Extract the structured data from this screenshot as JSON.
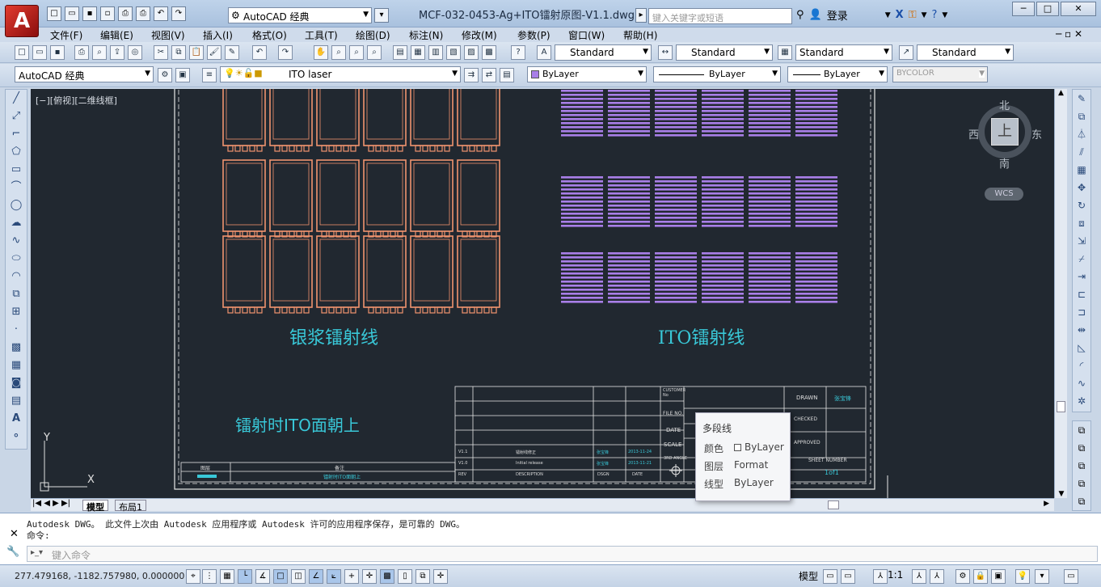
{
  "app": {
    "logo_letter": "A",
    "title": "MCF-032-0453-Ag+ITO镭射原图-V1.1.dwg",
    "workspace": "AutoCAD 经典",
    "search_placeholder": "键入关键字或短语",
    "login": "登录"
  },
  "menus": [
    "文件(F)",
    "编辑(E)",
    "视图(V)",
    "插入(I)",
    "格式(O)",
    "工具(T)",
    "绘图(D)",
    "标注(N)",
    "修改(M)",
    "参数(P)",
    "窗口(W)",
    "帮助(H)"
  ],
  "styles": {
    "text_style": "Standard",
    "dim_style": "Standard",
    "table_style": "Standard",
    "mleader_style": "Standard"
  },
  "layers": {
    "workspace2": "AutoCAD 经典",
    "current_layer": "ITO laser",
    "color": "ByLayer",
    "linetype": "ByLayer",
    "lineweight": "ByLayer",
    "plotstyle": "BYCOLOR"
  },
  "viewport": {
    "label": "[−][俯视][二维线框]"
  },
  "viewcube": {
    "north": "北",
    "south": "南",
    "east": "东",
    "west": "西",
    "top_face": "上",
    "wcs": "WCS"
  },
  "drawing": {
    "label_silver": "银浆镭射线",
    "label_ito": "ITO镭射线",
    "note_ito_up": "镭射时ITO面朝上",
    "title_block": {
      "customer": "CUSTOMER No",
      "file_no": "FILE NO.",
      "date": "DATE",
      "scale": "SCALE",
      "angle": "3RD ANGLE",
      "drawn": "DRAWN",
      "drawn_by": "张宝锋",
      "checked": "CHECKED",
      "approved": "APPROVED",
      "sheet_number": "SHEET NUMBER",
      "sheet": "1of1",
      "rows": [
        {
          "rev": "V1.1",
          "desc": "镭射线修正",
          "dsgn": "张宝锋",
          "date": "2013-11-24"
        },
        {
          "rev": "V1.0",
          "desc": "Initial release",
          "dsgn": "张宝锋",
          "date": "2013-11-21"
        }
      ],
      "hdr_rev": "REV",
      "hdr_desc": "DESCRIPTION",
      "hdr_dsgn": "DSGN",
      "hdr_date": "DATE",
      "legend_layer": "图层",
      "legend_note": "备注",
      "legend_note_val": "镭射时ITO面朝上"
    }
  },
  "tabs": {
    "model": "模型",
    "layout1": "布局1"
  },
  "tooltip": {
    "title": "多段线",
    "color_label": "颜色",
    "color_value": "ByLayer",
    "layer_label": "图层",
    "layer_value": "Format",
    "linetype_label": "线型",
    "linetype_value": "ByLayer"
  },
  "command": {
    "line1": "Autodesk DWG。  此文件上次由 Autodesk 应用程序或 Autodesk 许可的应用程序保存，是可靠的 DWG。",
    "line2": "命令:",
    "input_placeholder": "键入命令"
  },
  "status": {
    "coords": "277.479168, -1182.757980, 0.000000",
    "model": "模型",
    "scale": "1:1"
  },
  "colors": {
    "silver": "#f0936e",
    "ito": "#a97fe8",
    "canvas": "#212830",
    "annotation": "#39c8d8"
  }
}
